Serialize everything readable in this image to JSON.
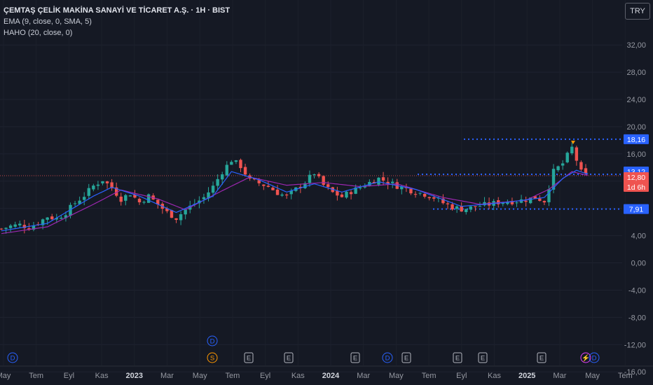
{
  "legend": {
    "symbol_title": "ÇEMTAŞ ÇELİK MAKİNA SANAYİ VE TİCARET A.Ş. · 1H · BIST",
    "indicator_1": "EMA (9, close, 0, SMA, 5)",
    "indicator_2": "HAHO (20, close, 0)"
  },
  "currency_button": "TRY",
  "price_axis": {
    "ticks": [
      "32,00",
      "28,00",
      "24,00",
      "20,00",
      "16,00",
      "12,00",
      "8,00",
      "4,00",
      "0,00",
      "-4,00",
      "-8,00",
      "-12,00",
      "-16,00"
    ],
    "ticks_values": [
      32,
      28,
      24,
      20,
      16,
      12,
      8,
      4,
      0,
      -4,
      -8,
      -12,
      -16
    ]
  },
  "price_labels": {
    "resistance": "18,16",
    "ema": "13,12",
    "last": "12,80",
    "countdown": "1d 6h",
    "support": "7,91"
  },
  "time_axis": [
    "May",
    "Tem",
    "Eyl",
    "Kas",
    "2023",
    "Mar",
    "May",
    "Tem",
    "Eyl",
    "Kas",
    "2024",
    "Mar",
    "May",
    "Tem",
    "Eyl",
    "Kas",
    "2025",
    "Mar",
    "May",
    "Tem"
  ],
  "events": [
    {
      "label": "D",
      "kind": "dividend"
    },
    {
      "label": "D",
      "kind": "dividend"
    },
    {
      "label": "S",
      "kind": "split"
    },
    {
      "label": "E",
      "kind": "earnings"
    },
    {
      "label": "E",
      "kind": "earnings"
    },
    {
      "label": "E",
      "kind": "earnings"
    },
    {
      "label": "D",
      "kind": "dividend"
    },
    {
      "label": "E",
      "kind": "earnings"
    },
    {
      "label": "E",
      "kind": "earnings"
    },
    {
      "label": "E",
      "kind": "earnings"
    },
    {
      "label": "E",
      "kind": "earnings"
    },
    {
      "label": "⚡",
      "kind": "flash"
    },
    {
      "label": "D",
      "kind": "dividend"
    }
  ],
  "colors": {
    "background": "#151924",
    "up": "#26a69a",
    "down": "#ef5350",
    "ema": "#2962ff",
    "haho": "#9c27b0",
    "level_line": "#2962ff",
    "last_price_line": "#ef5350",
    "dividend": "#2962ff",
    "split": "#ff9800",
    "earnings": "#b2b5be"
  },
  "chart_data": {
    "type": "candlestick",
    "y_range": [
      -16.8,
      35
    ],
    "levels": {
      "resistance": 18.16,
      "support": 7.91,
      "last": 12.8,
      "ema_last": 13.12
    },
    "close_path": [
      [
        0,
        5.0
      ],
      [
        2,
        5.4
      ],
      [
        4,
        5.6
      ],
      [
        6,
        5.2
      ],
      [
        8,
        5.9
      ],
      [
        10,
        6.8
      ],
      [
        12,
        6.5
      ],
      [
        14,
        7.4
      ],
      [
        16,
        8.8
      ],
      [
        18,
        9.9
      ],
      [
        20,
        11.3
      ],
      [
        22,
        12.2
      ],
      [
        24,
        11.0
      ],
      [
        26,
        9.4
      ],
      [
        28,
        10.2
      ],
      [
        30,
        8.9
      ],
      [
        32,
        9.8
      ],
      [
        34,
        8.6
      ],
      [
        36,
        7.4
      ],
      [
        38,
        6.6
      ],
      [
        40,
        7.8
      ],
      [
        42,
        8.7
      ],
      [
        44,
        9.6
      ],
      [
        46,
        11.2
      ],
      [
        48,
        13.4
      ],
      [
        50,
        15.1
      ],
      [
        52,
        14.2
      ],
      [
        54,
        12.1
      ],
      [
        56,
        11.7
      ],
      [
        58,
        11.2
      ],
      [
        60,
        10.3
      ],
      [
        62,
        9.7
      ],
      [
        64,
        10.8
      ],
      [
        66,
        11.9
      ],
      [
        68,
        13.2
      ],
      [
        70,
        11.4
      ],
      [
        72,
        10.3
      ],
      [
        74,
        9.7
      ],
      [
        76,
        10.5
      ],
      [
        78,
        11.1
      ],
      [
        80,
        11.8
      ],
      [
        82,
        12.4
      ],
      [
        84,
        11.9
      ],
      [
        86,
        11.3
      ],
      [
        88,
        10.9
      ],
      [
        90,
        10.4
      ],
      [
        92,
        10.1
      ],
      [
        94,
        9.6
      ],
      [
        96,
        8.8
      ],
      [
        98,
        8.2
      ],
      [
        100,
        7.9
      ],
      [
        102,
        8.1
      ],
      [
        104,
        8.4
      ],
      [
        106,
        8.6
      ],
      [
        108,
        8.9
      ],
      [
        110,
        9.0
      ],
      [
        112,
        9.1
      ],
      [
        114,
        9.3
      ],
      [
        116,
        9.6
      ],
      [
        118,
        9.1
      ],
      [
        120,
        13.4
      ],
      [
        122,
        14.6
      ],
      [
        124,
        16.9
      ],
      [
        126,
        13.3
      ],
      [
        127,
        12.8
      ]
    ],
    "ema_path": [
      [
        0,
        4.7
      ],
      [
        10,
        5.8
      ],
      [
        20,
        9.8
      ],
      [
        24,
        11.1
      ],
      [
        30,
        9.8
      ],
      [
        38,
        7.4
      ],
      [
        46,
        9.8
      ],
      [
        50,
        13.4
      ],
      [
        56,
        12.2
      ],
      [
        62,
        10.4
      ],
      [
        68,
        11.6
      ],
      [
        74,
        10.4
      ],
      [
        82,
        11.9
      ],
      [
        90,
        10.8
      ],
      [
        100,
        8.3
      ],
      [
        110,
        8.9
      ],
      [
        118,
        9.6
      ],
      [
        122,
        12.4
      ],
      [
        125,
        13.6
      ],
      [
        127,
        13.12
      ]
    ],
    "haho_path": [
      [
        0,
        4.3
      ],
      [
        10,
        5.3
      ],
      [
        20,
        8.6
      ],
      [
        26,
        10.7
      ],
      [
        34,
        9.4
      ],
      [
        40,
        7.8
      ],
      [
        48,
        10.6
      ],
      [
        54,
        12.6
      ],
      [
        62,
        11.4
      ],
      [
        70,
        11.8
      ],
      [
        78,
        11.2
      ],
      [
        86,
        11.6
      ],
      [
        96,
        9.6
      ],
      [
        104,
        8.6
      ],
      [
        114,
        9.2
      ],
      [
        119,
        10.8
      ],
      [
        124,
        13.4
      ],
      [
        127,
        12.9
      ]
    ]
  }
}
